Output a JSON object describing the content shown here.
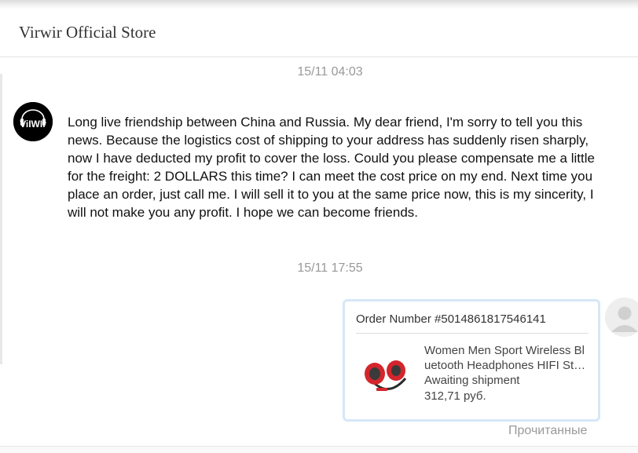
{
  "header": {
    "title": "Virwir Official Store"
  },
  "messages": [
    {
      "timestamp": "15/11 04:03",
      "sender_avatar": {
        "label": "ViIWIr",
        "icon": "store-logo-icon"
      },
      "text": "Long live friendship between China and Russia. My dear friend, I'm sorry to tell you this news. Because the logistics cost of shipping to your address has suddenly risen sharply, now I have deducted my profit to cover the loss. Could you please compensate me a little for the freight: 2 DOLLARS this time? I can meet the cost price on my end. Next time you place an order, just call me. I will sell it to you at the same price now, this is my sincerity, I will not make you any profit. I hope we can become friends."
    },
    {
      "timestamp": "15/11 17:55",
      "order_card": {
        "order_number": "Order Number #5014861817546141",
        "product_name_line1": "Women Men Sport Wireless Bl",
        "product_name_line2": "uetooth Headphones HIFI Stereo",
        "status": "Awaiting shipment",
        "price": "312,71 руб.",
        "thumbnail_icon": "red-headphones-icon"
      },
      "user_avatar_icon": "user-silhouette-icon",
      "read_status": "Прочитанные"
    }
  ],
  "colors": {
    "card_border": "#d5e8f8",
    "timestamp": "#999999",
    "headphone_red": "#d3262c"
  }
}
